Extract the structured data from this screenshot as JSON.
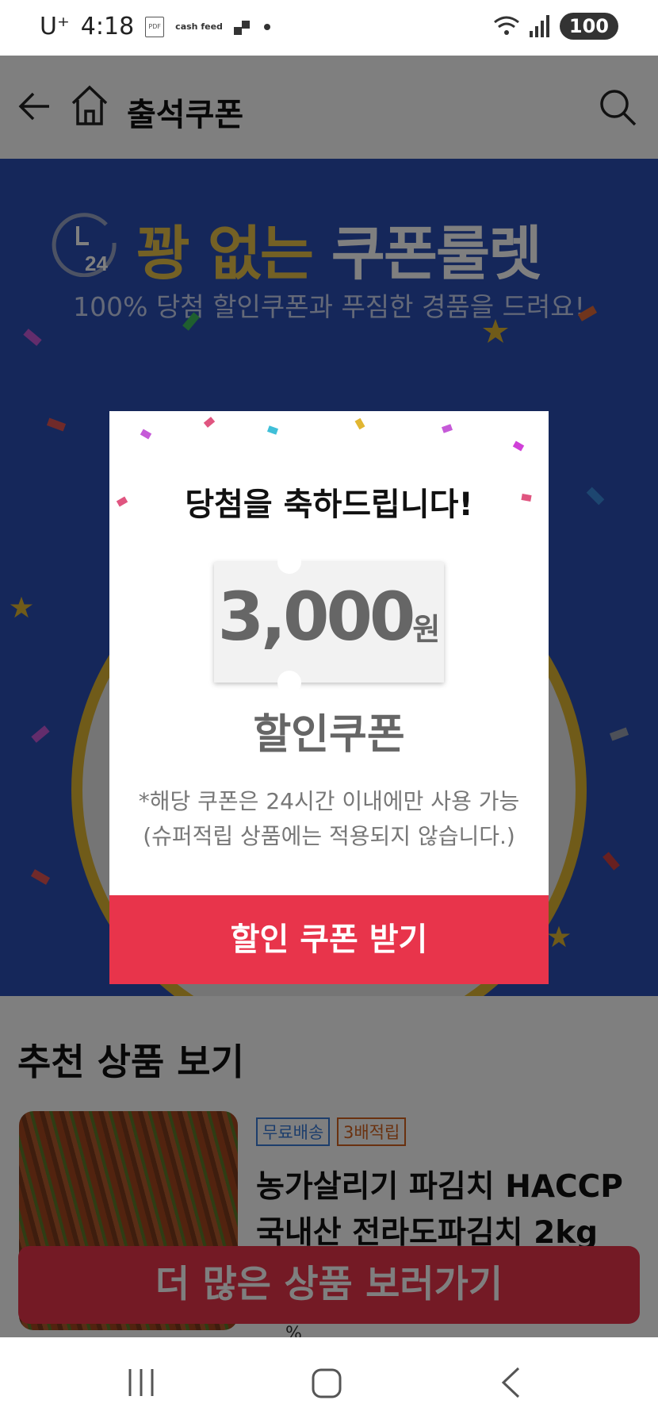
{
  "status_bar": {
    "carrier": "U⁺",
    "time": "4:18",
    "cash_label": "cash feed",
    "battery": "100"
  },
  "header": {
    "title": "출석쿠폰"
  },
  "banner": {
    "clock_label": "24",
    "title_gold": "꽝 없는",
    "title_white": "쿠폰룰렛",
    "subtitle": "100% 당첨 할인쿠폰과 푸짐한 경품을 드려요!"
  },
  "recommend": {
    "title": "추천 상품 보기",
    "product": {
      "badges": [
        "무료배송",
        "3배적립"
      ],
      "name_line1": "농가살리기 파김치 HACCP",
      "name_line2": "국내산 전라도파김치 2kg"
    },
    "more_button": "더 많은 상품 보러가기",
    "percent_fragment": "%"
  },
  "modal": {
    "title": "당첨을 축하드립니다!",
    "coupon_amount": "3,000",
    "coupon_unit": "원",
    "coupon_label": "할인쿠폰",
    "note_line1": "*해당 쿠폰은 24시간 이내에만 사용 가능",
    "note_line2": "(슈퍼적립 상품에는 적용되지 않습니다.)",
    "button": "할인 쿠폰 받기"
  },
  "colors": {
    "accent_red": "#e8344b",
    "banner_blue": "#2b4fb4",
    "gold": "#e9c24a"
  }
}
